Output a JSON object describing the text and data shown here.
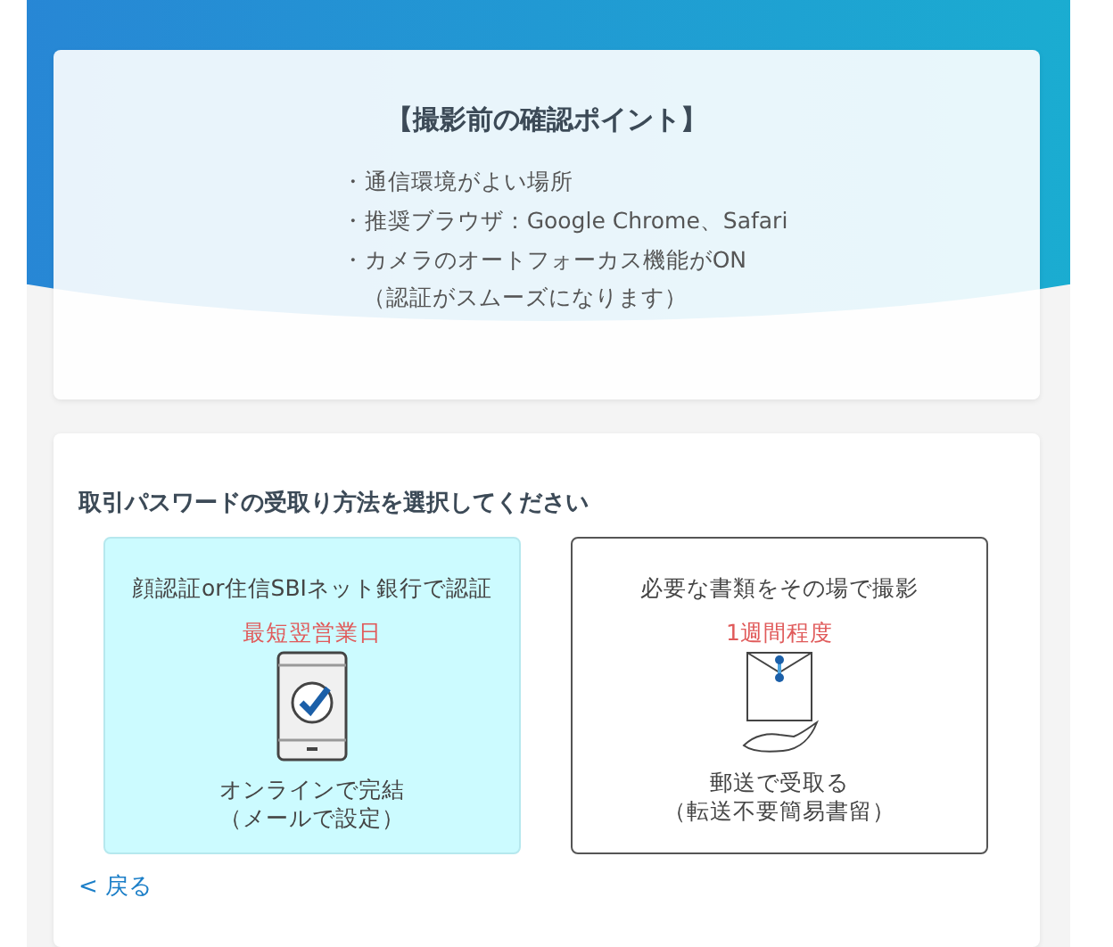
{
  "checklist": {
    "title": "【撮影前の確認ポイント】",
    "items": [
      {
        "text": "・通信環境がよい場所"
      },
      {
        "text": "・推奨ブラウザ：Google Chrome、Safari"
      },
      {
        "text": "・カメラのオートフォーカス機能がON",
        "note": "（認証がスムーズになります）"
      }
    ]
  },
  "method": {
    "heading": "取引パスワードの受取り方法を選択してください",
    "options": [
      {
        "kind": "phone",
        "selected": true,
        "title": "顔認証or住信SBIネット銀行で認証",
        "timing": "最短翌営業日",
        "lines": [
          "オンラインで完結",
          "（メールで設定）"
        ]
      },
      {
        "kind": "mail",
        "selected": false,
        "title": "必要な書類をその場で撮影",
        "timing": "1週間程度",
        "lines": [
          "郵送で受取る",
          "（転送不要簡易書留）"
        ]
      }
    ],
    "back": "< 戻る"
  }
}
